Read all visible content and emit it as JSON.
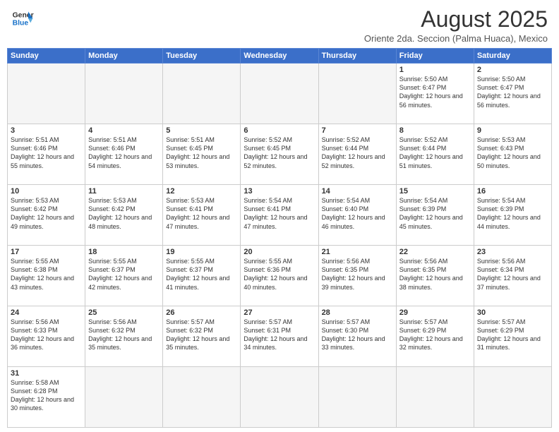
{
  "header": {
    "logo_line1": "General",
    "logo_line2": "Blue",
    "title": "August 2025",
    "subtitle": "Oriente 2da. Seccion (Palma Huaca), Mexico"
  },
  "days_of_week": [
    "Sunday",
    "Monday",
    "Tuesday",
    "Wednesday",
    "Thursday",
    "Friday",
    "Saturday"
  ],
  "weeks": [
    [
      {
        "day": "",
        "info": ""
      },
      {
        "day": "",
        "info": ""
      },
      {
        "day": "",
        "info": ""
      },
      {
        "day": "",
        "info": ""
      },
      {
        "day": "",
        "info": ""
      },
      {
        "day": "1",
        "info": "Sunrise: 5:50 AM\nSunset: 6:47 PM\nDaylight: 12 hours\nand 56 minutes."
      },
      {
        "day": "2",
        "info": "Sunrise: 5:50 AM\nSunset: 6:47 PM\nDaylight: 12 hours\nand 56 minutes."
      }
    ],
    [
      {
        "day": "3",
        "info": "Sunrise: 5:51 AM\nSunset: 6:46 PM\nDaylight: 12 hours\nand 55 minutes."
      },
      {
        "day": "4",
        "info": "Sunrise: 5:51 AM\nSunset: 6:46 PM\nDaylight: 12 hours\nand 54 minutes."
      },
      {
        "day": "5",
        "info": "Sunrise: 5:51 AM\nSunset: 6:45 PM\nDaylight: 12 hours\nand 53 minutes."
      },
      {
        "day": "6",
        "info": "Sunrise: 5:52 AM\nSunset: 6:45 PM\nDaylight: 12 hours\nand 52 minutes."
      },
      {
        "day": "7",
        "info": "Sunrise: 5:52 AM\nSunset: 6:44 PM\nDaylight: 12 hours\nand 52 minutes."
      },
      {
        "day": "8",
        "info": "Sunrise: 5:52 AM\nSunset: 6:44 PM\nDaylight: 12 hours\nand 51 minutes."
      },
      {
        "day": "9",
        "info": "Sunrise: 5:53 AM\nSunset: 6:43 PM\nDaylight: 12 hours\nand 50 minutes."
      }
    ],
    [
      {
        "day": "10",
        "info": "Sunrise: 5:53 AM\nSunset: 6:42 PM\nDaylight: 12 hours\nand 49 minutes."
      },
      {
        "day": "11",
        "info": "Sunrise: 5:53 AM\nSunset: 6:42 PM\nDaylight: 12 hours\nand 48 minutes."
      },
      {
        "day": "12",
        "info": "Sunrise: 5:53 AM\nSunset: 6:41 PM\nDaylight: 12 hours\nand 47 minutes."
      },
      {
        "day": "13",
        "info": "Sunrise: 5:54 AM\nSunset: 6:41 PM\nDaylight: 12 hours\nand 47 minutes."
      },
      {
        "day": "14",
        "info": "Sunrise: 5:54 AM\nSunset: 6:40 PM\nDaylight: 12 hours\nand 46 minutes."
      },
      {
        "day": "15",
        "info": "Sunrise: 5:54 AM\nSunset: 6:39 PM\nDaylight: 12 hours\nand 45 minutes."
      },
      {
        "day": "16",
        "info": "Sunrise: 5:54 AM\nSunset: 6:39 PM\nDaylight: 12 hours\nand 44 minutes."
      }
    ],
    [
      {
        "day": "17",
        "info": "Sunrise: 5:55 AM\nSunset: 6:38 PM\nDaylight: 12 hours\nand 43 minutes."
      },
      {
        "day": "18",
        "info": "Sunrise: 5:55 AM\nSunset: 6:37 PM\nDaylight: 12 hours\nand 42 minutes."
      },
      {
        "day": "19",
        "info": "Sunrise: 5:55 AM\nSunset: 6:37 PM\nDaylight: 12 hours\nand 41 minutes."
      },
      {
        "day": "20",
        "info": "Sunrise: 5:55 AM\nSunset: 6:36 PM\nDaylight: 12 hours\nand 40 minutes."
      },
      {
        "day": "21",
        "info": "Sunrise: 5:56 AM\nSunset: 6:35 PM\nDaylight: 12 hours\nand 39 minutes."
      },
      {
        "day": "22",
        "info": "Sunrise: 5:56 AM\nSunset: 6:35 PM\nDaylight: 12 hours\nand 38 minutes."
      },
      {
        "day": "23",
        "info": "Sunrise: 5:56 AM\nSunset: 6:34 PM\nDaylight: 12 hours\nand 37 minutes."
      }
    ],
    [
      {
        "day": "24",
        "info": "Sunrise: 5:56 AM\nSunset: 6:33 PM\nDaylight: 12 hours\nand 36 minutes."
      },
      {
        "day": "25",
        "info": "Sunrise: 5:56 AM\nSunset: 6:32 PM\nDaylight: 12 hours\nand 35 minutes."
      },
      {
        "day": "26",
        "info": "Sunrise: 5:57 AM\nSunset: 6:32 PM\nDaylight: 12 hours\nand 35 minutes."
      },
      {
        "day": "27",
        "info": "Sunrise: 5:57 AM\nSunset: 6:31 PM\nDaylight: 12 hours\nand 34 minutes."
      },
      {
        "day": "28",
        "info": "Sunrise: 5:57 AM\nSunset: 6:30 PM\nDaylight: 12 hours\nand 33 minutes."
      },
      {
        "day": "29",
        "info": "Sunrise: 5:57 AM\nSunset: 6:29 PM\nDaylight: 12 hours\nand 32 minutes."
      },
      {
        "day": "30",
        "info": "Sunrise: 5:57 AM\nSunset: 6:29 PM\nDaylight: 12 hours\nand 31 minutes."
      }
    ],
    [
      {
        "day": "31",
        "info": "Sunrise: 5:58 AM\nSunset: 6:28 PM\nDaylight: 12 hours\nand 30 minutes."
      },
      {
        "day": "",
        "info": ""
      },
      {
        "day": "",
        "info": ""
      },
      {
        "day": "",
        "info": ""
      },
      {
        "day": "",
        "info": ""
      },
      {
        "day": "",
        "info": ""
      },
      {
        "day": "",
        "info": ""
      }
    ]
  ]
}
